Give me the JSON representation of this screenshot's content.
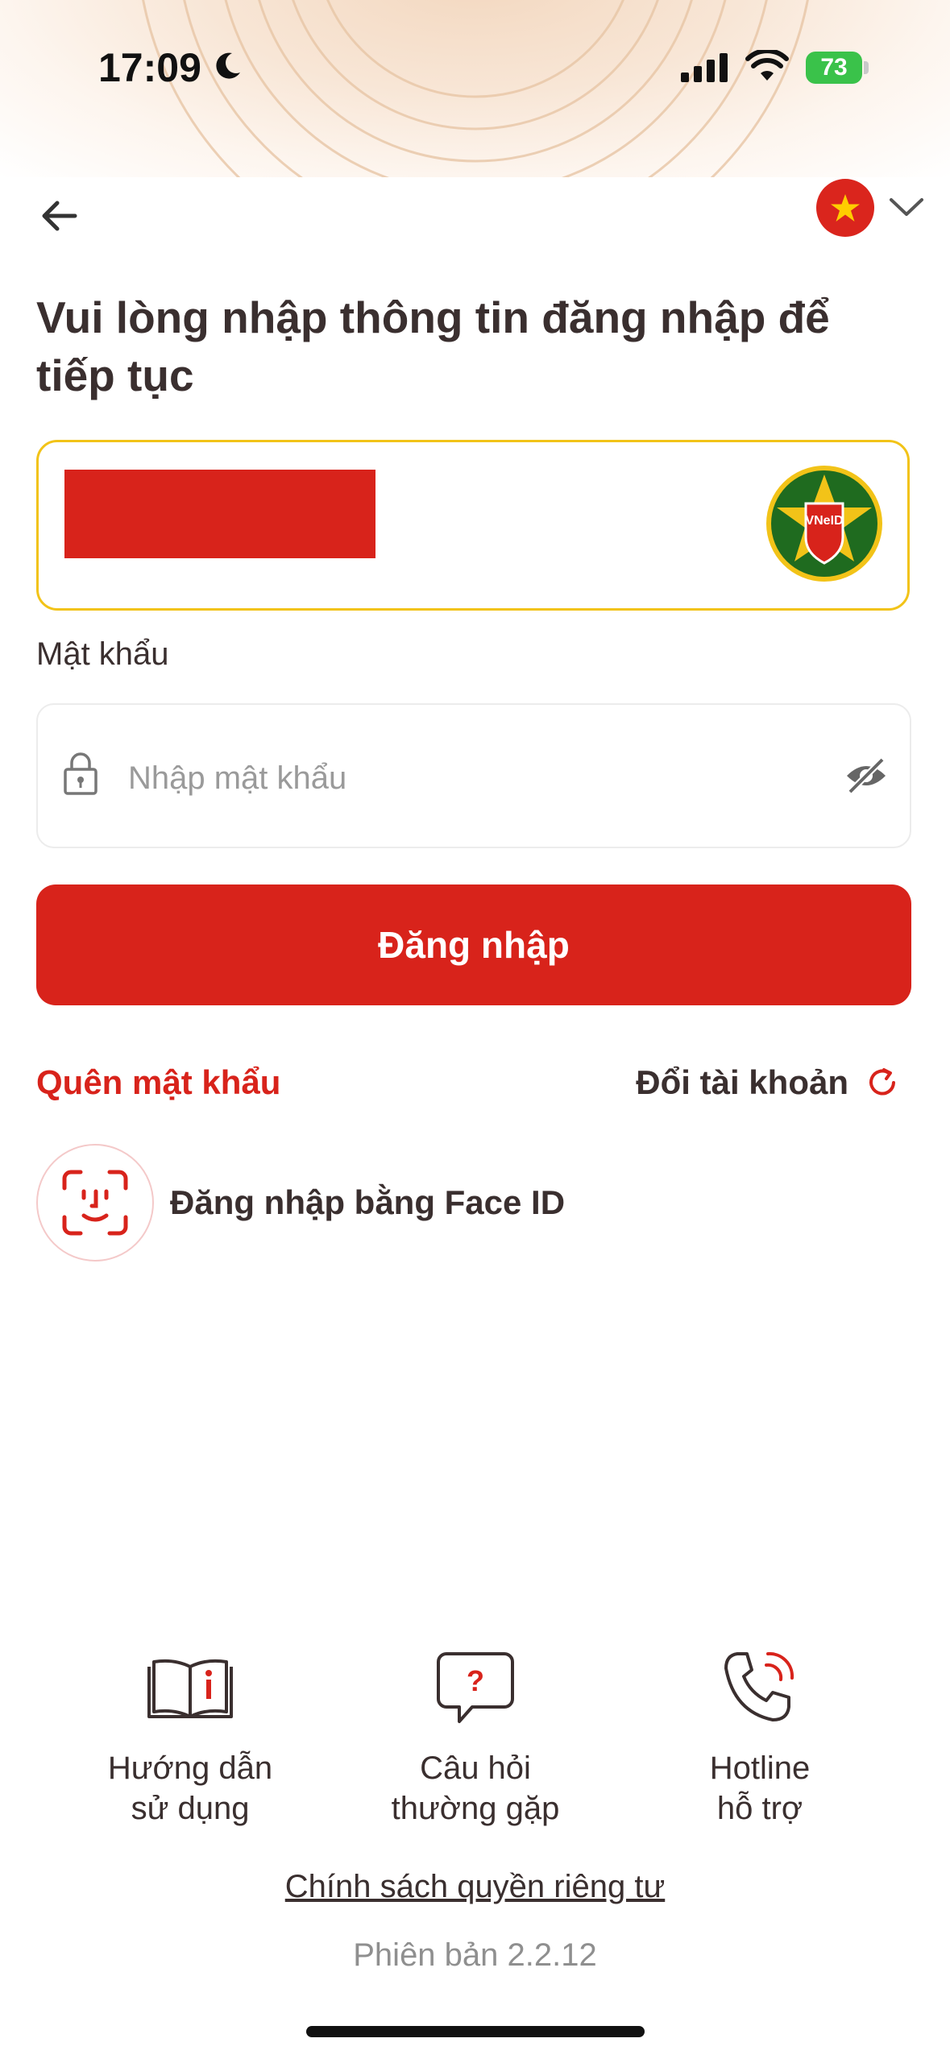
{
  "status_bar": {
    "time": "17:09",
    "battery": "73"
  },
  "language": {
    "flag": "vietnam-flag-icon"
  },
  "title": "Vui lòng nhập thông tin đăng nhập để tiếp tục",
  "password": {
    "label": "Mật khẩu",
    "placeholder": "Nhập mật khẩu"
  },
  "login_button": "Đăng nhập",
  "forgot_password": "Quên mật khẩu",
  "switch_account": "Đổi tài khoản",
  "face_id": "Đăng nhập bằng Face ID",
  "badge_text": "VNeID",
  "shortcuts": [
    {
      "line1": "Hướng dẫn",
      "line2": "sử dụng"
    },
    {
      "line1": "Câu hỏi",
      "line2": "thường gặp"
    },
    {
      "line1": "Hotline",
      "line2": "hỗ trợ"
    }
  ],
  "privacy_policy": "Chính sách quyền riêng tư",
  "version": "Phiên bản 2.2.12",
  "colors": {
    "accent": "#d8231b",
    "highlight_border": "#f2c318",
    "text": "#3a2f2f"
  }
}
